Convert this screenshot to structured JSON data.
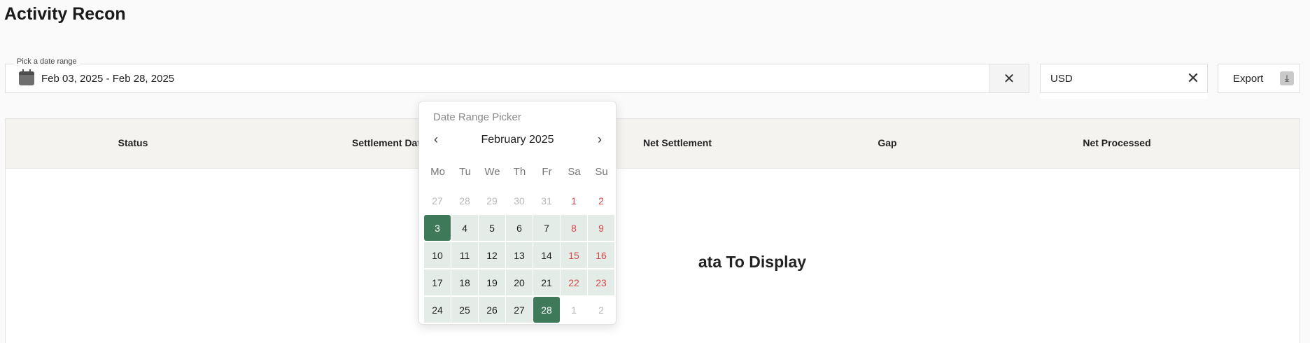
{
  "page": {
    "title": "Activity Recon"
  },
  "date_filter": {
    "label": "Pick a date range",
    "value": "Feb 03, 2025 - Feb 28, 2025",
    "clear_icon": "close-icon",
    "calendar_icon": "calendar-icon"
  },
  "currency_filter": {
    "value": "USD",
    "clear_icon": "close-icon"
  },
  "export": {
    "label": "Export",
    "icon": "download-icon"
  },
  "table": {
    "columns": [
      "Status",
      "Settlement Dat",
      "Net Settlement",
      "Gap",
      "Net Processed"
    ],
    "empty_message": "ata To Display"
  },
  "date_picker": {
    "title": "Date Range Picker",
    "month": "February 2025",
    "prev_icon": "chevron-left-icon",
    "next_icon": "chevron-right-icon",
    "weekdays": [
      "Mo",
      "Tu",
      "We",
      "Th",
      "Fr",
      "Sa",
      "Su"
    ],
    "days": [
      {
        "d": "27",
        "s": "muted"
      },
      {
        "d": "28",
        "s": "muted"
      },
      {
        "d": "29",
        "s": "muted"
      },
      {
        "d": "30",
        "s": "muted"
      },
      {
        "d": "31",
        "s": "muted"
      },
      {
        "d": "1",
        "s": "weekend"
      },
      {
        "d": "2",
        "s": "weekend"
      },
      {
        "d": "3",
        "s": "selected"
      },
      {
        "d": "4",
        "s": "inrange"
      },
      {
        "d": "5",
        "s": "inrange"
      },
      {
        "d": "6",
        "s": "inrange"
      },
      {
        "d": "7",
        "s": "inrange"
      },
      {
        "d": "8",
        "s": "inrange weekend"
      },
      {
        "d": "9",
        "s": "inrange weekend"
      },
      {
        "d": "10",
        "s": "inrange"
      },
      {
        "d": "11",
        "s": "inrange"
      },
      {
        "d": "12",
        "s": "inrange"
      },
      {
        "d": "13",
        "s": "inrange"
      },
      {
        "d": "14",
        "s": "inrange"
      },
      {
        "d": "15",
        "s": "inrange weekend"
      },
      {
        "d": "16",
        "s": "inrange weekend"
      },
      {
        "d": "17",
        "s": "inrange"
      },
      {
        "d": "18",
        "s": "inrange"
      },
      {
        "d": "19",
        "s": "inrange"
      },
      {
        "d": "20",
        "s": "inrange"
      },
      {
        "d": "21",
        "s": "inrange"
      },
      {
        "d": "22",
        "s": "inrange weekend"
      },
      {
        "d": "23",
        "s": "inrange weekend"
      },
      {
        "d": "24",
        "s": "inrange"
      },
      {
        "d": "25",
        "s": "inrange"
      },
      {
        "d": "26",
        "s": "inrange"
      },
      {
        "d": "27",
        "s": "inrange"
      },
      {
        "d": "28",
        "s": "selected"
      },
      {
        "d": "1",
        "s": "muted"
      },
      {
        "d": "2",
        "s": "muted"
      }
    ]
  },
  "colors": {
    "accent": "#3e7a5a",
    "range_fill": "#e3ece6",
    "weekend": "#d9484d",
    "header_bg": "#f5f3f0"
  }
}
